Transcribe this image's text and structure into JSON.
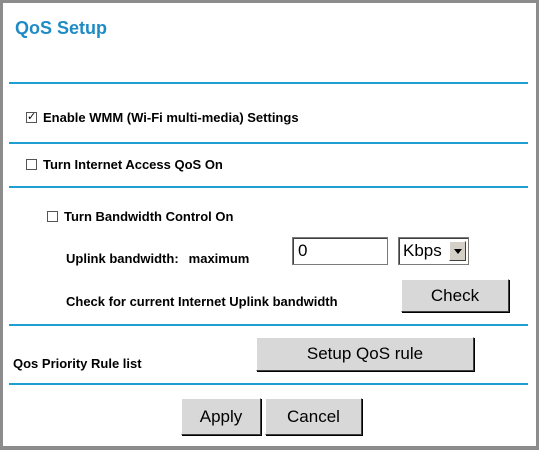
{
  "title": "QoS Setup",
  "wmm": {
    "label": "Enable WMM (Wi-Fi multi-media) Settings",
    "checked": true
  },
  "internet_qos": {
    "label": "Turn Internet Access QoS On",
    "checked": false
  },
  "bandwidth_control": {
    "label": "Turn Bandwidth Control On",
    "checked": false
  },
  "uplink": {
    "label": "Uplink bandwidth:",
    "maximum_label": "maximum",
    "value": "0",
    "unit": "Kbps"
  },
  "check_row": {
    "label": "Check for current Internet Uplink bandwidth",
    "button": "Check"
  },
  "priority_rule": {
    "label": "Qos Priority Rule list",
    "button": "Setup QoS rule"
  },
  "actions": {
    "apply": "Apply",
    "cancel": "Cancel"
  },
  "colors": {
    "accent": "#1f9ed1",
    "title": "#1f8bc5"
  }
}
